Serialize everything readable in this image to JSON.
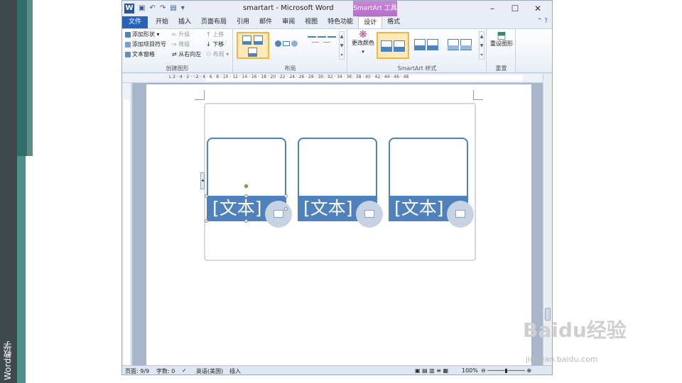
{
  "slide_side_caption": "Word教学",
  "window": {
    "title": "smartart - Microsoft Word",
    "context_tab_label": "SmartArt 工具",
    "controls": [
      "–",
      "☐",
      "✕"
    ]
  },
  "tabs": [
    "文件",
    "开始",
    "插入",
    "页面布局",
    "引用",
    "邮件",
    "审阅",
    "视图",
    "特色功能",
    "设计",
    "格式"
  ],
  "active_tab": "设计",
  "ribbon": {
    "create_graphic": {
      "label": "创建图形",
      "add_shape": "添加形状",
      "add_bullet": "添加项目符号",
      "text_pane": "文本窗格",
      "promote": "升级",
      "demote": "降级",
      "right_to_left": "从右向左",
      "move_up": "上移",
      "move_down": "下移",
      "layout": "布局"
    },
    "layouts": {
      "label": "布局"
    },
    "smartart_styles": {
      "label": "SmartArt 样式",
      "change_colors": "更改颜色"
    },
    "reset": {
      "label": "重置",
      "reset_graphic": "重设图形"
    }
  },
  "ruler_ticks": "L  2 · 4 · 2 ·  · 2 · 4 · 6 · 8 · 10 · 12 · 14 · 16 · 18 · 20 · 22 · 24 · 26 · 28 · 30 · 32 · 34 · 36 · 38 · 40 · 42 · 44 · 46 · 48",
  "smartart": {
    "placeholder": "[文本]",
    "cards": 3
  },
  "status": {
    "page": "页面: 9/9",
    "words": "字数: 0",
    "language": "英语(美国)",
    "mode": "插入",
    "zoom": "100%"
  },
  "watermark": {
    "brand": "Baidu经验",
    "url": "jingyan.baidu.com"
  },
  "colors": {
    "accent": "#4f81bd",
    "file_tab": "#2a62b8",
    "context_tab": "#b46fc6"
  }
}
